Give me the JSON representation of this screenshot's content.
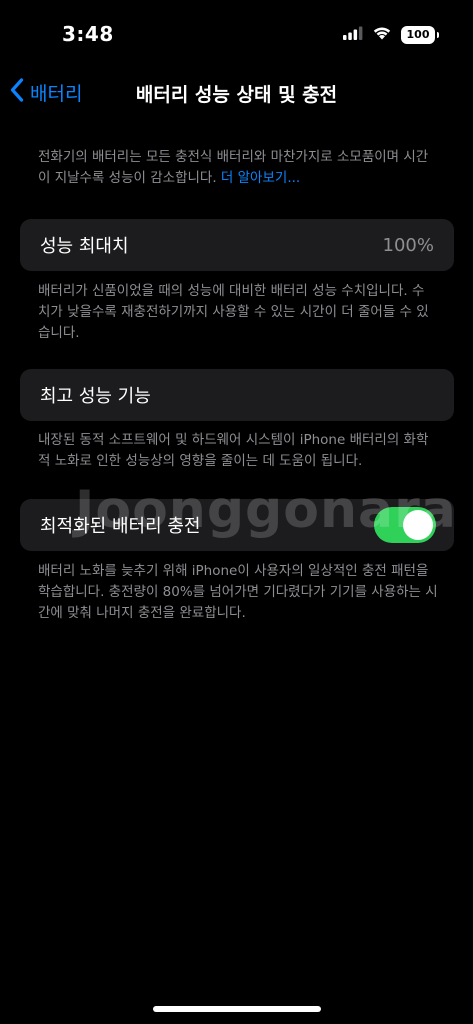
{
  "status_bar": {
    "time": "3:48",
    "battery_level": "100"
  },
  "nav": {
    "back_label": "배터리",
    "title": "배터리 성능 상태 및 충전"
  },
  "intro": {
    "text": "전화기의 배터리는 모든 충전식 배터리와 마찬가지로 소모품이며 시간이 지날수록 성능이 감소합니다.",
    "link": "더 알아보기..."
  },
  "max_capacity": {
    "label": "성능 최대치",
    "value": "100%",
    "footer": "배터리가 신품이었을 때의 성능에 대비한 배터리 성능 수치입니다. 수치가 낮을수록 재충전하기까지 사용할 수 있는 시간이 더 줄어들 수 있습니다."
  },
  "peak_performance": {
    "label": "최고 성능 기능",
    "footer": "내장된 동적 소프트웨어 및 하드웨어 시스템이 iPhone 배터리의 화학적 노화로 인한 성능상의 영향을 줄이는 데 도움이 됩니다."
  },
  "optimized_charging": {
    "label": "최적화된 배터리 충전",
    "enabled": true,
    "footer": "배터리 노화를 늦추기 위해 iPhone이 사용자의 일상적인 충전 패턴을 학습합니다. 충전량이 80%를 넘어가면 기다렸다가 기기를 사용하는 시간에 맞춰 나머지 충전을 완료합니다."
  },
  "watermark": "Joonggonara",
  "colors": {
    "accent": "#0a84ff",
    "toggle_on": "#30d158",
    "cell_bg": "#1c1c1e",
    "secondary_text": "#8e8e93"
  }
}
